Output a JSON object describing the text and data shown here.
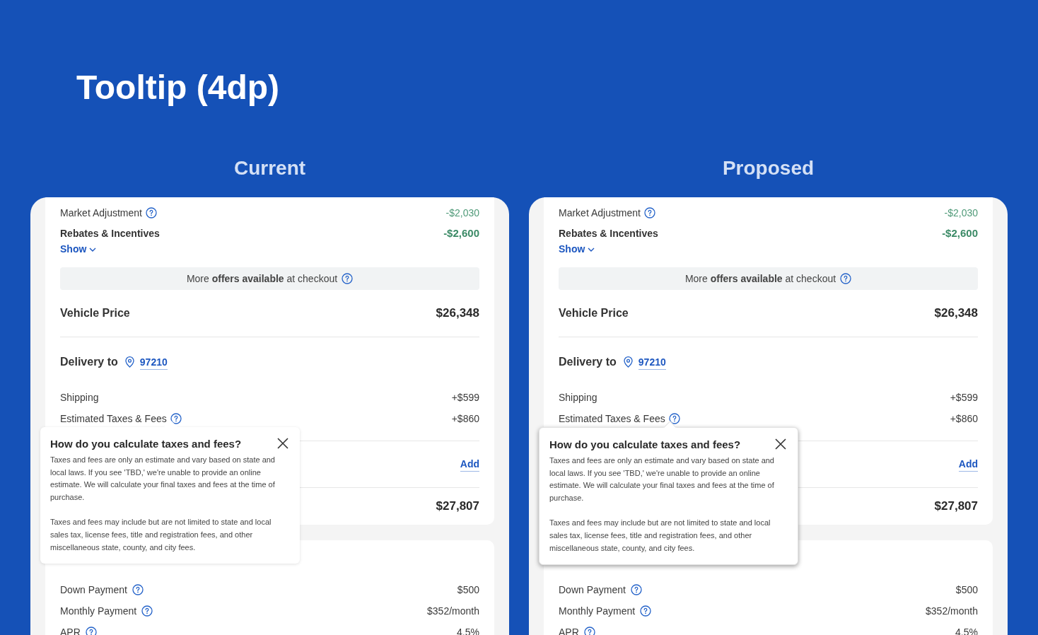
{
  "title": "Tooltip (4dp)",
  "panels": [
    {
      "heading": "Current",
      "market_adjustment": {
        "label": "Market Adjustment",
        "value": "-$2,030",
        "help": true
      },
      "rebates": {
        "label": "Rebates & Incentives",
        "value": "-$2,600",
        "toggle": "Show"
      },
      "offers_banner": "More **offers available** at checkout",
      "vehicle_price": {
        "label": "Vehicle Price",
        "value": "$26,348"
      },
      "delivery": {
        "label": "Delivery to",
        "zip": "97210"
      },
      "fees": [
        {
          "label": "Shipping",
          "value": "+$599",
          "help": false
        },
        {
          "label": "Estimated Taxes & Fees",
          "value": "+$860",
          "help": true
        }
      ],
      "add_action": "Add",
      "total": "$27,807",
      "payments": [
        {
          "label": "Down Payment",
          "value": "$500"
        },
        {
          "label": "Monthly Payment",
          "value": "$352/month"
        },
        {
          "label": "APR",
          "value": "4.5%"
        }
      ],
      "tooltip": {
        "kind": "light",
        "title": "How do you calculate taxes and fees?",
        "paragraphs": [
          "Taxes and fees are only an estimate and vary based on state and local laws. If you see 'TBD,' we're unable to provide an online estimate. We will calculate your final taxes and fees at the time of purchase.",
          "Taxes and fees may include but are not limited to state and local sales tax, license fees, title and registration fees, and other miscellaneous state, county, and city fees."
        ]
      }
    },
    {
      "heading": "Proposed",
      "market_adjustment": {
        "label": "Market Adjustment",
        "value": "-$2,030",
        "help": true
      },
      "rebates": {
        "label": "Rebates & Incentives",
        "value": "-$2,600",
        "toggle": "Show"
      },
      "offers_banner": "More **offers available** at checkout",
      "vehicle_price": {
        "label": "Vehicle Price",
        "value": "$26,348"
      },
      "delivery": {
        "label": "Delivery to",
        "zip": "97210"
      },
      "fees": [
        {
          "label": "Shipping",
          "value": "+$599",
          "help": false
        },
        {
          "label": "Estimated Taxes & Fees",
          "value": "+$860",
          "help": true
        }
      ],
      "add_action": "Add",
      "total": "$27,807",
      "payments": [
        {
          "label": "Down Payment",
          "value": "$500"
        },
        {
          "label": "Monthly Payment",
          "value": "$352/month"
        },
        {
          "label": "APR",
          "value": "4.5%"
        }
      ],
      "tooltip": {
        "kind": "raised",
        "title": "How do you calculate taxes and fees?",
        "paragraphs": [
          "Taxes and fees are only an estimate and vary based on state and local laws. If you see 'TBD,' we're unable to provide an online estimate. We will calculate your final taxes and fees at the time of purchase.",
          "Taxes and fees may include but are not limited to state and local sales tax, license fees, title and registration fees, and other miscellaneous state, county, and city fees."
        ]
      }
    }
  ]
}
